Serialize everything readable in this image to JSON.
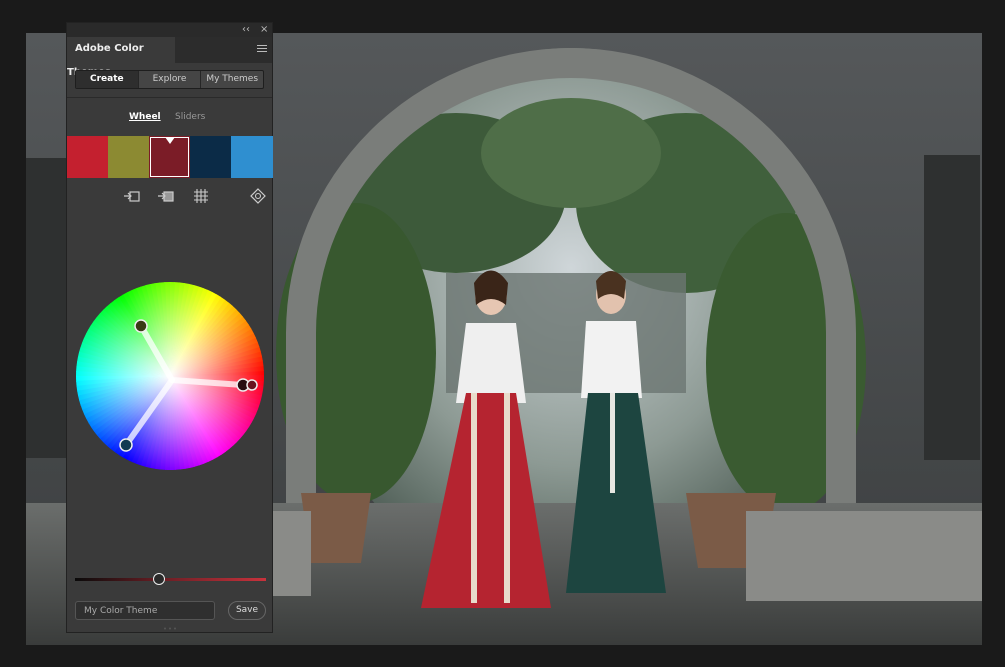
{
  "panel": {
    "title": "Adobe Color Themes",
    "collapse_glyph": "‹‹",
    "close_glyph": "×",
    "menu_icon": "hamburger-menu-icon",
    "tabs": [
      {
        "label": "Create",
        "active": true
      },
      {
        "label": "Explore",
        "active": false
      },
      {
        "label": "My Themes",
        "active": false
      }
    ],
    "modes": [
      {
        "label": "Wheel",
        "active": true
      },
      {
        "label": "Sliders",
        "active": false
      }
    ],
    "swatches": [
      {
        "color": "#c4202f",
        "selected": false
      },
      {
        "color": "#8c8a32",
        "selected": false
      },
      {
        "color": "#7b1c27",
        "selected": true
      },
      {
        "color": "#0b2b47",
        "selected": false
      },
      {
        "color": "#2f8fd0",
        "selected": false
      }
    ],
    "tools": [
      "add-to-swatches-icon",
      "add-to-swatches-alt-icon",
      "color-grid-icon",
      "color-harmony-icon"
    ],
    "brightness": 0.44,
    "theme_name_placeholder": "My Color Theme",
    "save_label": "Save"
  },
  "canvas": {
    "scene": "photo"
  }
}
